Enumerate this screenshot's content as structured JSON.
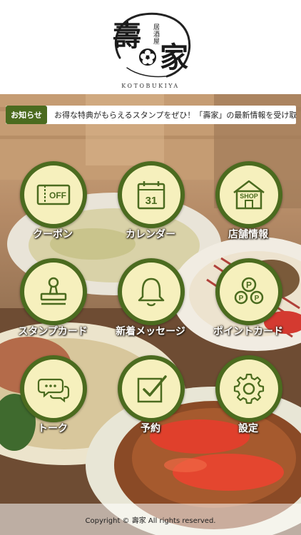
{
  "logo": {
    "kanji_main_1": "壽",
    "kanji_main_2": "家",
    "subtitle": "居酒屋",
    "roman": "KOTOBUKIYA"
  },
  "ticker": {
    "badge": "お知らせ",
    "message": "お得な特典がもらえるスタンプをぜひ！「壽家」の最新情報を受け取るにはアプリの通知をオンにしてください"
  },
  "menu": {
    "items": [
      {
        "label": "クーポン",
        "icon": "coupon-off-icon",
        "icon_text": "OFF"
      },
      {
        "label": "カレンダー",
        "icon": "calendar-icon",
        "icon_text": "31"
      },
      {
        "label": "店舗情報",
        "icon": "shop-icon",
        "icon_text": "SHOP"
      },
      {
        "label": "スタンプカード",
        "icon": "stamp-icon"
      },
      {
        "label": "新着メッセージ",
        "icon": "bell-icon"
      },
      {
        "label": "ポイントカード",
        "icon": "points-icon",
        "icon_text": "P"
      },
      {
        "label": "トーク",
        "icon": "chat-icon"
      },
      {
        "label": "予約",
        "icon": "reservation-check-icon"
      },
      {
        "label": "設定",
        "icon": "gear-icon"
      }
    ]
  },
  "footer": {
    "copyright": "Copyright © 壽家 All rights reserved."
  },
  "colors": {
    "accent_green": "#4b6b1f",
    "icon_fill": "#f6f0bd",
    "label_text": "#ffffff"
  }
}
